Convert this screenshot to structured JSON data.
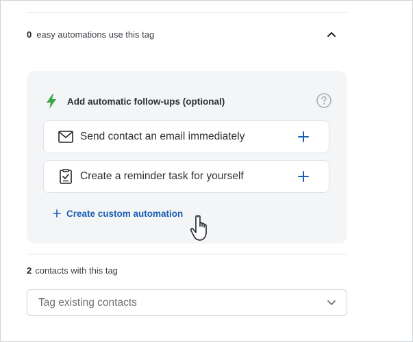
{
  "automations": {
    "count": "0",
    "label": "easy automations use this tag"
  },
  "followups": {
    "title": "Add automatic follow-ups (optional)",
    "items": [
      {
        "label": "Send contact an email immediately",
        "icon": "envelope-icon"
      },
      {
        "label": "Create a reminder task for yourself",
        "icon": "clipboard-check-icon"
      }
    ],
    "custom_link": "Create custom automation"
  },
  "contacts": {
    "count": "2",
    "label": "contacts with this tag"
  },
  "tag_select": {
    "placeholder": "Tag existing contacts"
  },
  "colors": {
    "accent_blue": "#1a5fb4",
    "lightning_green": "#3aa64a",
    "panel_bg": "#f4f5f6"
  }
}
